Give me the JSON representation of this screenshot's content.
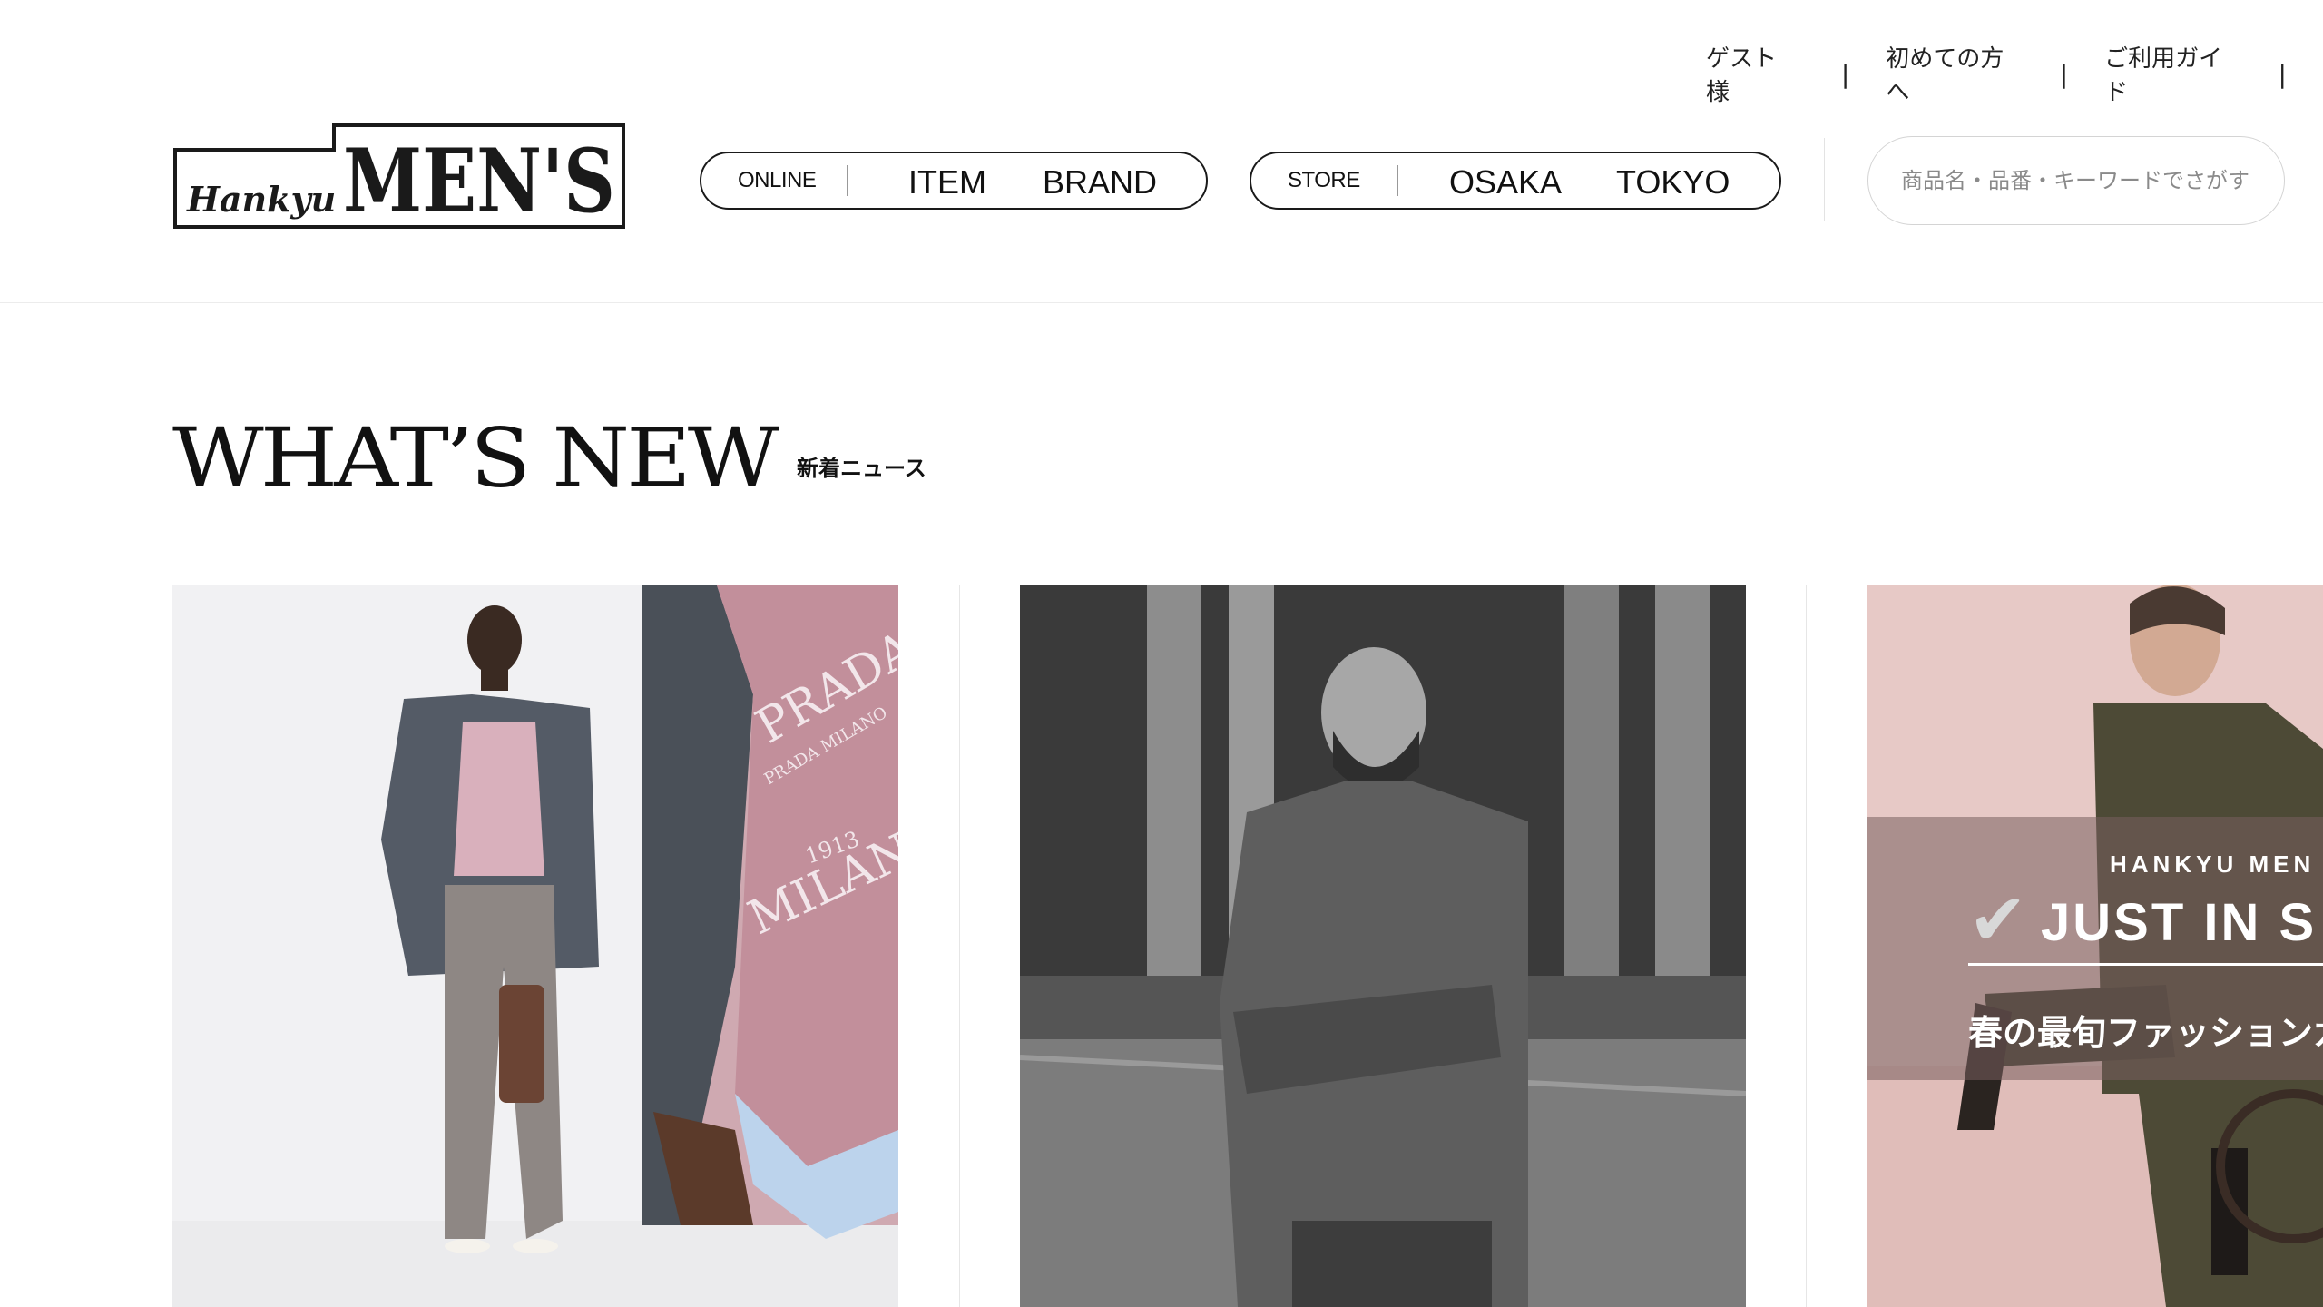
{
  "utility_nav": {
    "guest": "ゲスト 様",
    "first_time": "初めての方へ",
    "guide": "ご利用ガイド",
    "separator": "|"
  },
  "logo": {
    "small_text": "Hankyu",
    "large_text": "MEN'S"
  },
  "nav": {
    "online": {
      "label": "ONLINE",
      "links": [
        "ITEM",
        "BRAND"
      ]
    },
    "store": {
      "label": "STORE",
      "links": [
        "OSAKA",
        "TOKYO"
      ]
    }
  },
  "search": {
    "placeholder": "商品名・品番・キーワードでさがす"
  },
  "section": {
    "title": "WHAT’S NEW",
    "subtitle": "新着ニュース"
  },
  "cards": [
    {
      "image_text": [
        "PRADA",
        "PRADA MILANO",
        "1913",
        "MILANO"
      ]
    },
    {
      "image_text": []
    },
    {
      "overlay_brand": "HANKYU MEN",
      "overlay_headline": "JUST IN S",
      "overlay_sub": "春の最旬ファッションガ"
    }
  ],
  "colors": {
    "text": "#1a1a1a",
    "border": "#1a1a1a",
    "search_border": "#d4d4d4",
    "card3_bg": "#e7c9c6"
  }
}
